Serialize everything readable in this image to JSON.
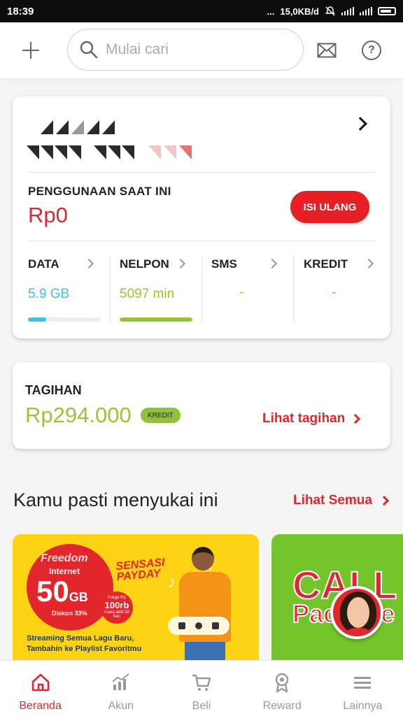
{
  "colors": {
    "brand_red": "#e0272b",
    "data_blue": "#3cc3e6",
    "call_green": "#9ac436",
    "sms_orange": "#f0a020",
    "credit_teal": "#4cc4c8",
    "status_bar": "#0d0d0d"
  },
  "status_bar": {
    "time": "18:39",
    "network_speed": "15,0KB/d",
    "dots": "...",
    "network_type": "4G"
  },
  "header": {
    "add_icon": "plus-icon",
    "search_icon": "search-icon",
    "search_placeholder": "Mulai cari",
    "mail_icon": "mail-icon",
    "help_icon": "help-icon",
    "help_glyph": "?"
  },
  "usage_card": {
    "label": "PENGGUNAAN SAAT INI",
    "amount": "Rp0",
    "topup_label": "ISI ULANG",
    "quotas": [
      {
        "label": "DATA",
        "value": "5.9 GB",
        "fill_fraction": 0.25,
        "color": "#3cc3e6"
      },
      {
        "label": "NELPON",
        "value": "5097 min",
        "fill_fraction": 1.0,
        "color": "#9ac436"
      },
      {
        "label": "SMS",
        "value": "-",
        "color": "#f0a020"
      },
      {
        "label": "KREDIT",
        "value": "-",
        "color": "#4cc4c8"
      }
    ]
  },
  "bill_card": {
    "label": "TAGIHAN",
    "amount": "Rp294.000",
    "badge": "KREDIT",
    "link": "Lihat tagihan"
  },
  "recommendations": {
    "title": "Kamu pasti menyukai ini",
    "see_all": "Lihat Semua",
    "promos": [
      {
        "brand": "Freedom",
        "internet": "Internet",
        "size": "50",
        "size_unit": "GB",
        "discount": "Diskon 33%",
        "price_prefix": "Harga Rp",
        "price": "100rb",
        "price_note": "masa aktif 30 hari",
        "payday_1": "SENSASI",
        "payday_2": "PAYDAY",
        "caption_1": "Streaming Semua Lagu Baru,",
        "caption_2": "Tambahin ke Playlist Favoritmu"
      },
      {
        "title_1": "CALL",
        "title_2": "Package"
      }
    ]
  },
  "bottom_nav": [
    {
      "label": "Beranda",
      "icon": "home-icon",
      "active": true
    },
    {
      "label": "Akun",
      "icon": "chart-icon",
      "active": false
    },
    {
      "label": "Beli",
      "icon": "cart-icon",
      "active": false
    },
    {
      "label": "Reward",
      "icon": "medal-icon",
      "active": false
    },
    {
      "label": "Lainnya",
      "icon": "menu-icon",
      "active": false
    }
  ]
}
